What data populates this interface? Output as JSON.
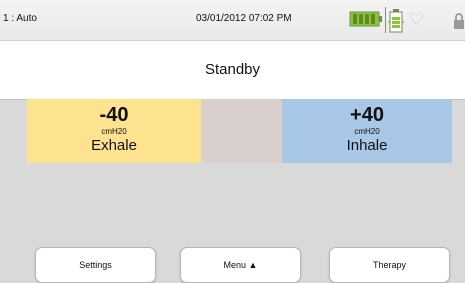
{
  "status_bar": {
    "mode": "1 : Auto",
    "datetime": "03/01/2012 07:02 PM",
    "icons": [
      "battery-icon",
      "battery-vertical-icon",
      "heart-icon",
      "lock-icon"
    ]
  },
  "title": "Standby",
  "pressure": {
    "exhale": {
      "value": "-40",
      "unit": "cmH20",
      "label": "Exhale",
      "color": "#fde28f"
    },
    "inhale": {
      "value": "+40",
      "unit": "cmH20",
      "label": "Inhale",
      "color": "#a9c7e7"
    }
  },
  "buttons": {
    "settings": "Settings",
    "menu": "Menu ▲",
    "therapy": "Therapy"
  }
}
